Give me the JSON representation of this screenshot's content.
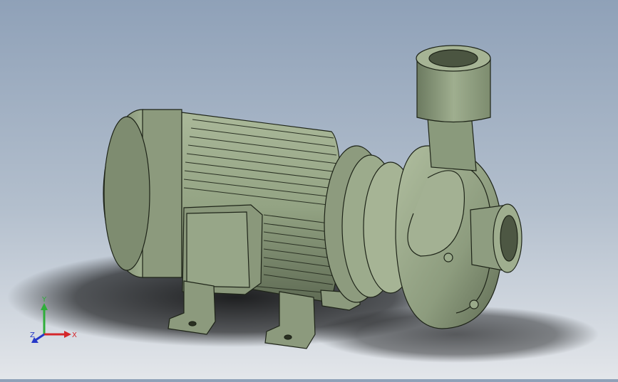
{
  "viewport": {
    "background_top": "#8fa1b8",
    "background_bottom": "#e3e6ea",
    "model": {
      "name": "centrifugal-pump-assembly",
      "body_color": "#9aaa8a",
      "shade_color": "#6f7d62",
      "edge_color": "#1e2418"
    }
  },
  "triad": {
    "x_label": "X",
    "y_label": "Y",
    "z_label": "Z",
    "x_color": "#d4262a",
    "y_color": "#2fae3a",
    "z_color": "#2638c8"
  }
}
